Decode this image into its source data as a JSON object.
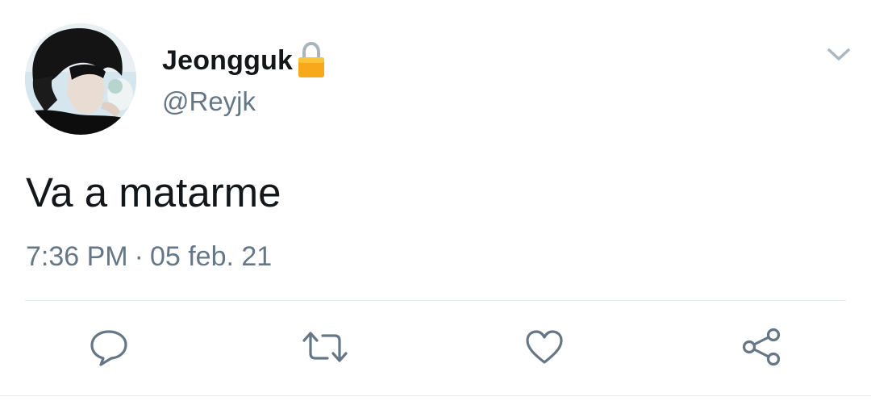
{
  "tweet": {
    "display_name": "Jeongguk",
    "handle": "@Reyjk",
    "text": "Va a matarme",
    "time": "7:36 PM",
    "separator": "·",
    "date": "05 feb. 21"
  },
  "icons": {
    "lock": "lock-icon",
    "caret": "chevron-down-icon",
    "reply": "reply-icon",
    "retweet": "retweet-icon",
    "like": "heart-icon",
    "share": "share-icon"
  },
  "colors": {
    "primary_text": "#14171a",
    "secondary_text": "#657786",
    "icon": "#657786",
    "divider": "#e1e8ed",
    "lock": "#f7a81b"
  }
}
